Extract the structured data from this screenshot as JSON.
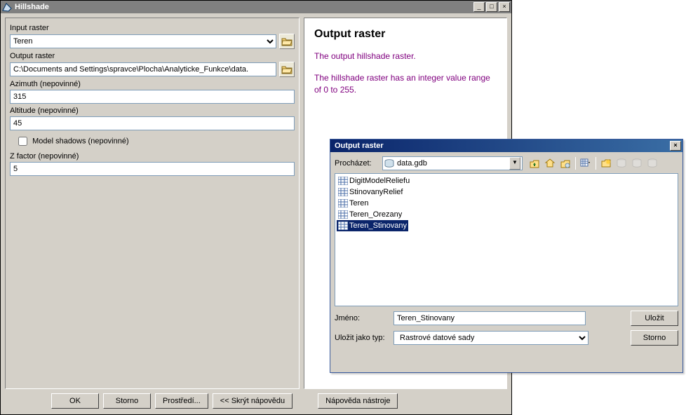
{
  "main": {
    "title": "Hillshade",
    "labels": {
      "input_raster": "Input raster",
      "output_raster": "Output raster",
      "azimuth": "Azimuth (nepovinné)",
      "altitude": "Altitude (nepovinné)",
      "model_shadows": "Model shadows (nepovinné)",
      "z_factor": "Z factor (nepovinné)"
    },
    "values": {
      "input_raster": "Teren",
      "output_raster": "C:\\Documents and Settings\\spravce\\Plocha\\Analyticke_Funkce\\data.",
      "azimuth": "315",
      "altitude": "45",
      "model_shadows_checked": false,
      "z_factor": "5"
    },
    "buttons": {
      "ok": "OK",
      "storno": "Storno",
      "prostredi": "Prostředí...",
      "skryt": "<< Skrýt nápovědu",
      "napoveda": "Nápověda nástroje"
    }
  },
  "help": {
    "title": "Output raster",
    "para1": "The output hillshade raster.",
    "para2": "The hillshade raster has an integer value range of 0 to 255."
  },
  "dialog": {
    "title": "Output raster",
    "browse_label": "Procházet:",
    "location": "data.gdb",
    "items": [
      "DigitModelReliefu",
      "StinovanyRelief",
      "Teren",
      "Teren_Orezany",
      "Teren_Stinovany"
    ],
    "selected_index": 4,
    "name_label": "Jméno:",
    "name_value": "Teren_Stinovany",
    "type_label": "Uložit jako typ:",
    "type_value": "Rastrové datové sady",
    "save": "Uložit",
    "cancel": "Storno"
  },
  "icons": {
    "folder": "folder-icon",
    "up": "up-one-level-icon",
    "home": "home-icon",
    "fav": "favorites-icon",
    "grid": "view-icon",
    "newfolder": "new-folder-icon"
  }
}
